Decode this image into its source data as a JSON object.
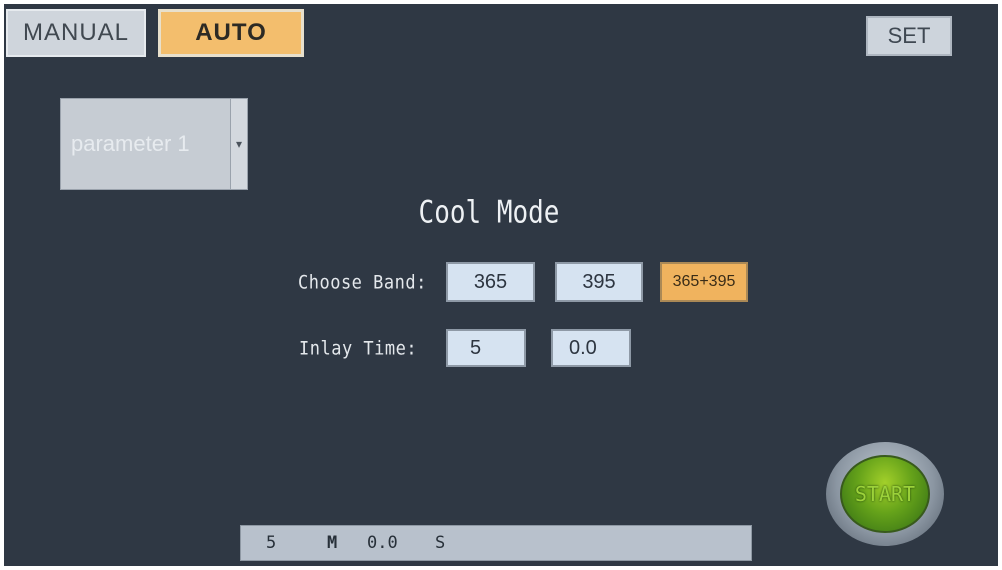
{
  "modes": {
    "manual_label": "MANUAL",
    "auto_label": "AUTO",
    "active": "AUTO"
  },
  "set_label": "SET",
  "parameter_select": {
    "value": "parameter 1",
    "arrow_icon": "dropdown-arrow-icon"
  },
  "title": "Cool Mode",
  "band": {
    "label": "Choose Band:",
    "options": [
      "365",
      "395",
      "365+395"
    ],
    "selected": "365+395"
  },
  "inlay_time": {
    "label": "Inlay Time:",
    "minutes": "5",
    "seconds": "0.0"
  },
  "start_label": "START",
  "status": {
    "minutes": "5",
    "minutes_unit": "M",
    "seconds": "0.0",
    "seconds_unit": "S"
  },
  "colors": {
    "background": "#2f3844",
    "active_accent": "#f3be6d",
    "value_button": "#d6e3f1",
    "start_green": "#65a21a"
  }
}
